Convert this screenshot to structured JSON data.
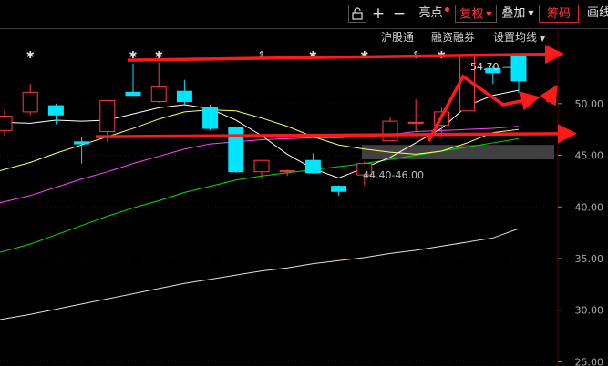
{
  "toolbar": {
    "lock_icon": "lock-icon",
    "plus_icon": "plus-icon",
    "minus_icon": "minus-icon",
    "brightness_label": "亮点",
    "adjust_label": "复权",
    "overlay_label": "叠加",
    "chips_label": "筹码",
    "draw_label": "画线"
  },
  "subbar": {
    "sh_connect": "沪股通",
    "margin": "融资融券",
    "ma_settings": "设置均线"
  },
  "colors": {
    "up": "#ff3b3b",
    "down": "#00e5ff",
    "ma5": "#ffffff",
    "ma10": "#ffff66",
    "ma20": "#ff44ff",
    "ma60": "#00dd00",
    "ma250": "#e0e0e0",
    "annotation": "#ff1a1a",
    "zone": "#555555"
  },
  "chart_data": {
    "type": "candlestick",
    "y_ticks": [
      "50.00",
      "45.00",
      "40.00",
      "35.00",
      "30.00",
      "25.00"
    ],
    "ylim": [
      24.6,
      57.3
    ],
    "candles": [
      {
        "o": 47.4,
        "c": 48.8,
        "h": 49.4,
        "l": 46.9
      },
      {
        "o": 49.2,
        "c": 51.1,
        "h": 51.9,
        "l": 48.9
      },
      {
        "o": 49.8,
        "c": 48.9,
        "h": 50.0,
        "l": 48.0
      },
      {
        "o": 46.3,
        "c": 46.1,
        "h": 46.8,
        "l": 44.2
      },
      {
        "o": 47.3,
        "c": 50.3,
        "h": 50.3,
        "l": 46.3
      },
      {
        "o": 51.1,
        "c": 50.8,
        "h": 53.9,
        "l": 50.8
      },
      {
        "o": 50.2,
        "c": 51.6,
        "h": 54.0,
        "l": 50.1
      },
      {
        "o": 51.2,
        "c": 50.2,
        "h": 52.3,
        "l": 49.9
      },
      {
        "o": 49.6,
        "c": 47.6,
        "h": 49.9,
        "l": 47.4
      },
      {
        "o": 47.7,
        "c": 43.4,
        "h": 47.8,
        "l": 43.3
      },
      {
        "o": 43.4,
        "c": 44.5,
        "h": 44.5,
        "l": 42.7
      },
      {
        "o": 43.4,
        "c": 43.5,
        "h": 43.6,
        "l": 43.0
      },
      {
        "o": 44.5,
        "c": 43.3,
        "h": 45.2,
        "l": 43.2
      },
      {
        "o": 42.0,
        "c": 41.5,
        "h": 42.1,
        "l": 41.1
      },
      {
        "o": 43.1,
        "c": 44.2,
        "h": 44.4,
        "l": 42.1
      },
      {
        "o": 46.4,
        "c": 48.3,
        "h": 48.7,
        "l": 46.4
      },
      {
        "o": 48.1,
        "c": 48.2,
        "h": 50.4,
        "l": 47.3
      },
      {
        "o": 47.9,
        "c": 49.2,
        "h": 49.6,
        "l": 46.8
      },
      {
        "o": 49.3,
        "c": 54.7,
        "h": 54.7,
        "l": 49.3
      },
      {
        "o": 53.4,
        "c": 53.0,
        "h": 53.6,
        "l": 51.9
      },
      {
        "o": 54.6,
        "c": 52.2,
        "h": 54.6,
        "l": 51.0
      }
    ],
    "ma5": [
      48.2,
      48.1,
      48.4,
      48.3,
      48.4,
      49.0,
      49.6,
      49.9,
      49.5,
      48.4,
      46.9,
      45.1,
      43.7,
      42.8,
      43.8,
      44.8,
      46.2,
      47.6,
      49.8,
      50.8,
      51.3
    ],
    "ma10": [
      43.5,
      44.3,
      45.2,
      46.0,
      46.8,
      47.6,
      48.5,
      49.2,
      49.4,
      49.3,
      48.6,
      47.8,
      46.8,
      46.0,
      45.6,
      45.3,
      45.1,
      45.4,
      46.2,
      47.2,
      47.5
    ],
    "ma20": [
      40.4,
      41.1,
      41.9,
      42.7,
      43.4,
      44.2,
      44.9,
      45.6,
      46.1,
      46.3,
      46.5,
      46.6,
      46.7,
      46.7,
      46.8,
      47.0,
      47.3,
      47.4,
      47.5,
      47.6,
      47.8
    ],
    "ma60": [
      35.6,
      36.4,
      37.3,
      38.2,
      39.1,
      39.9,
      40.6,
      41.4,
      42.0,
      42.6,
      43.0,
      43.3,
      43.6,
      43.9,
      44.2,
      44.6,
      45.0,
      45.4,
      45.8,
      46.2,
      46.6
    ],
    "ma250": [
      29.1,
      29.6,
      30.1,
      30.6,
      31.1,
      31.6,
      32.1,
      32.6,
      33.0,
      33.4,
      33.8,
      34.1,
      34.5,
      34.8,
      35.1,
      35.5,
      35.8,
      36.2,
      36.6,
      37.0,
      37.9
    ],
    "markers": [
      "✱",
      "✱",
      "✱",
      "⇕",
      "✱",
      "✱",
      "⇕",
      "✱"
    ],
    "high_label": "54.70",
    "zone": {
      "low": 44.6,
      "high": 46.0,
      "label": "44.40-46.00"
    },
    "upper_resistance": [
      54.2,
      54.8
    ],
    "lower_support": [
      46.8,
      47.1
    ]
  }
}
